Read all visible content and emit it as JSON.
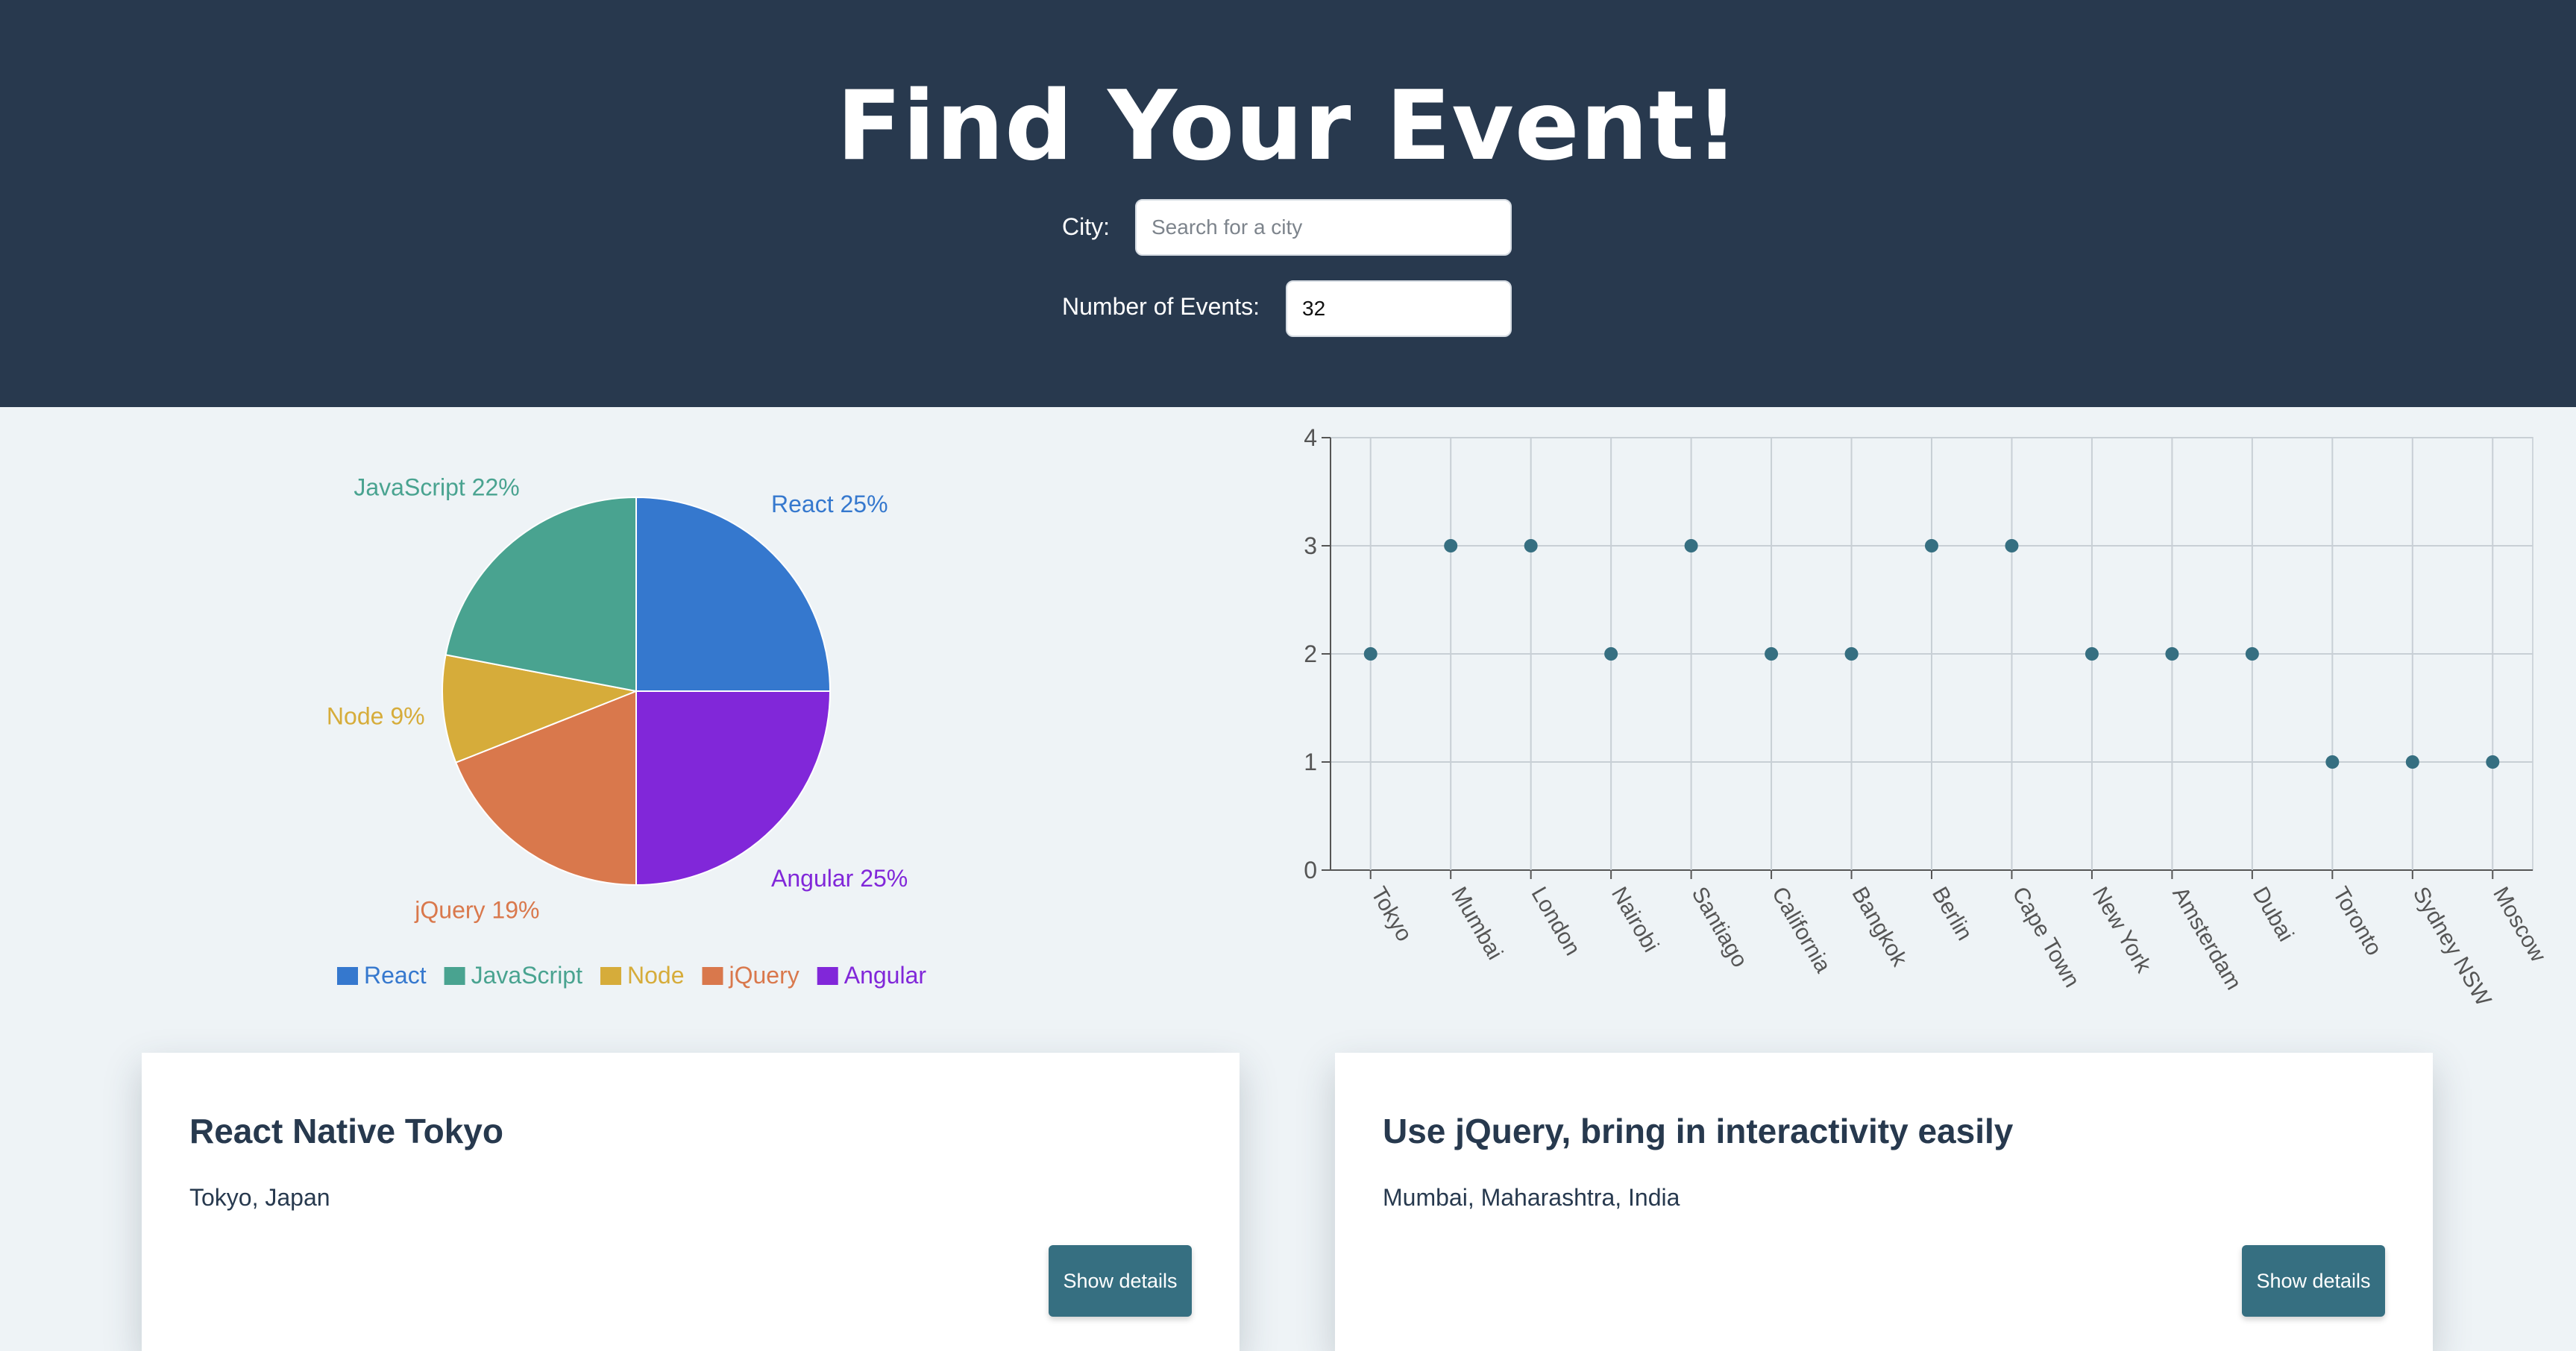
{
  "header": {
    "title": "Find Your Event!",
    "city_label": "City:",
    "city_placeholder": "Search for a city",
    "city_value": "",
    "events_label": "Number of Events:",
    "events_value": "32"
  },
  "colors": {
    "header_bg": "#28394e",
    "page_bg": "#eef3f6",
    "button": "#366f81",
    "scatter_point": "#366f81"
  },
  "chart_data": [
    {
      "type": "pie",
      "slices": [
        {
          "label": "React",
          "value": 25,
          "display": "React 25%",
          "color": "#3578ce"
        },
        {
          "label": "Angular",
          "value": 25,
          "display": "Angular 25%",
          "color": "#8127d9"
        },
        {
          "label": "jQuery",
          "value": 19,
          "display": "jQuery 19%",
          "color": "#d9784c"
        },
        {
          "label": "Node",
          "value": 9,
          "display": "Node 9%",
          "color": "#d6ac3a"
        },
        {
          "label": "JavaScript",
          "value": 22,
          "display": "JavaScript 22%",
          "color": "#49a390"
        }
      ],
      "legend": {
        "placement": "bottom",
        "entries": [
          {
            "label": "React",
            "color": "#3578ce"
          },
          {
            "label": "JavaScript",
            "color": "#49a390"
          },
          {
            "label": "Node",
            "color": "#d6ac3a"
          },
          {
            "label": "jQuery",
            "color": "#d9784c"
          },
          {
            "label": "Angular",
            "color": "#8127d9"
          }
        ]
      }
    },
    {
      "type": "scatter",
      "categories": [
        "Tokyo",
        "Mumbai",
        "London",
        "Nairobi",
        "Santiago",
        "California",
        "Bangkok",
        "Berlin",
        "Cape Town",
        "New York",
        "Amsterdam",
        "Dubai",
        "Toronto",
        "Sydney NSW",
        "Moscow"
      ],
      "values": [
        2,
        3,
        3,
        2,
        3,
        2,
        2,
        3,
        3,
        2,
        2,
        2,
        1,
        1,
        1
      ],
      "ylim": [
        0,
        4
      ],
      "yticks": [
        0,
        1,
        2,
        3,
        4
      ],
      "grid": true
    }
  ],
  "events": [
    {
      "title": "React Native Tokyo",
      "location": "Tokyo, Japan",
      "button_label": "Show details"
    },
    {
      "title": "Use jQuery, bring in interactivity easily",
      "location": "Mumbai, Maharashtra, India",
      "button_label": "Show details"
    }
  ]
}
